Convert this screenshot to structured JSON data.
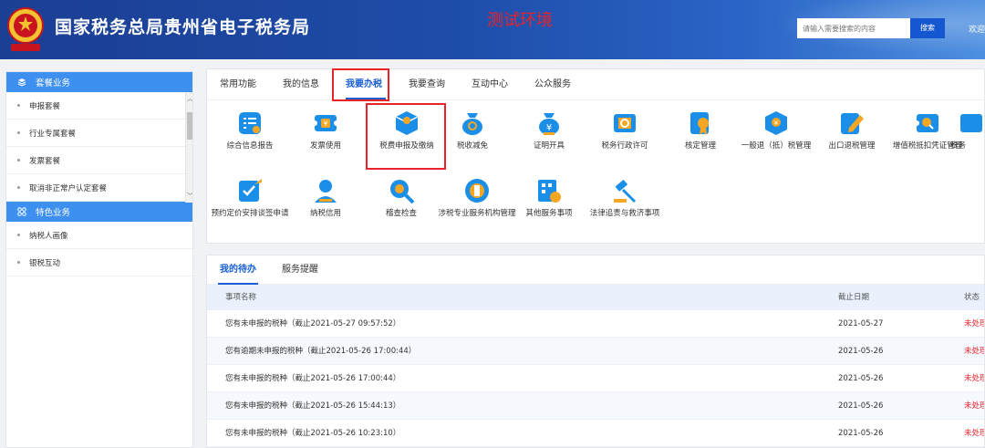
{
  "header": {
    "title": "国家税务总局贵州省电子税务局",
    "env_label": "测试环境",
    "search_placeholder": "请输入需要搜索的内容",
    "search_button": "搜索",
    "welcome": "欢迎"
  },
  "sidebar": {
    "groups": [
      {
        "title": "套餐业务",
        "icon": "layers-icon",
        "items": [
          "申报套餐",
          "行业专属套餐",
          "发票套餐",
          "取消非正常户认定套餐"
        ]
      },
      {
        "title": "特色业务",
        "icon": "grid-icon",
        "items": [
          "纳税人画像",
          "银税互动"
        ]
      }
    ]
  },
  "main": {
    "tabs": [
      "常用功能",
      "我的信息",
      "我要办税",
      "我要查询",
      "互动中心",
      "公众服务"
    ],
    "active_tab": "我要办税",
    "functions_row1": [
      "综合信息报告",
      "发票使用",
      "税费申报及缴纳",
      "税收减免",
      "证明开具",
      "税务行政许可",
      "核定管理",
      "一般退（抵）税管理",
      "出口退税管理",
      "增值税抵扣凭证管理",
      "税务"
    ],
    "functions_row2": [
      "预约定价安排谈签申请",
      "纳税信用",
      "稽查检查",
      "涉税专业服务机构管理",
      "其他服务事项",
      "法律追责与救济事项"
    ]
  },
  "todo": {
    "tabs": [
      "我的待办",
      "服务提醒"
    ],
    "columns": {
      "name": "事项名称",
      "date": "截止日期",
      "status": "状态"
    },
    "rows": [
      {
        "name": "您有未申报的税种（截止2021-05-27 09:57:52）",
        "date": "2021-05-27",
        "status": "未处理"
      },
      {
        "name": "您有逾期未申报的税种（截止2021-05-26 17:00:44）",
        "date": "2021-05-26",
        "status": "未处理"
      },
      {
        "name": "您有未申报的税种（截止2021-05-26 17:00:44）",
        "date": "2021-05-26",
        "status": "未处理"
      },
      {
        "name": "您有未申报的税种（截止2021-05-26 15:44:13）",
        "date": "2021-05-26",
        "status": "未处理"
      },
      {
        "name": "您有未申报的税种（截止2021-05-26 10:23:10）",
        "date": "2021-05-26",
        "status": "未处理"
      }
    ]
  },
  "colors": {
    "primary": "#1a5fd2",
    "header": "#1e4ca8",
    "highlight": "#e8232a",
    "icon_blue": "#1b8fe8",
    "icon_orange": "#f5a623"
  }
}
